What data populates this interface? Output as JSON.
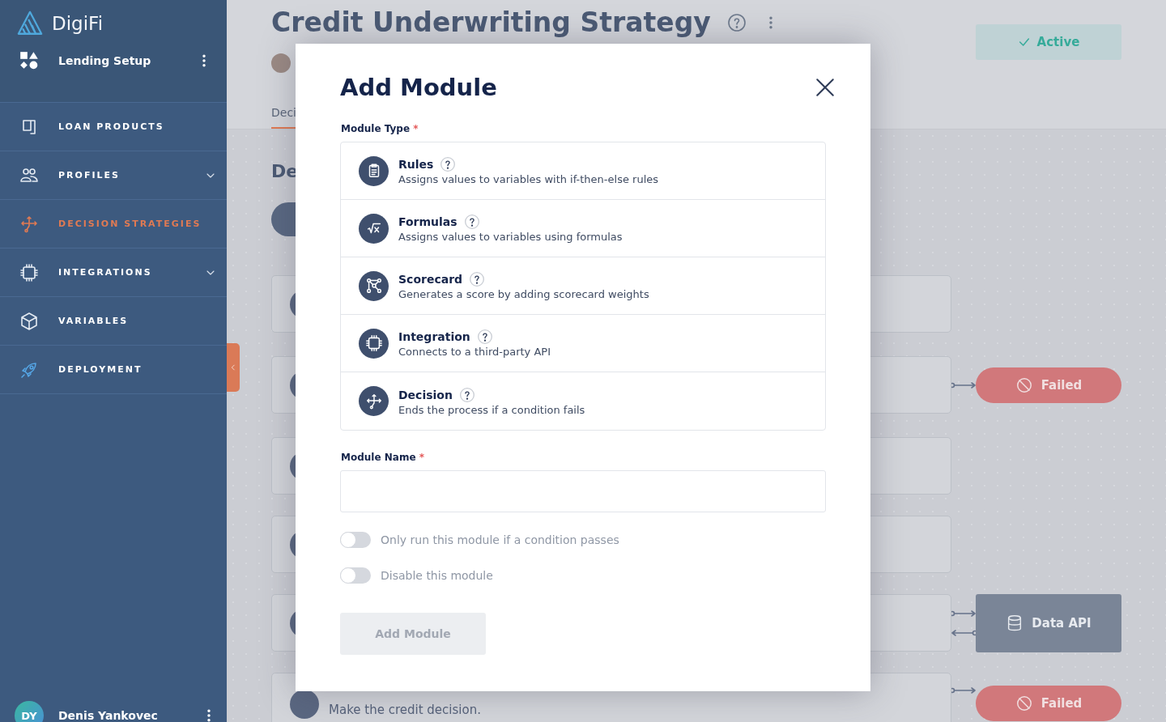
{
  "sidebar": {
    "logo": "DigiFi",
    "workspace": {
      "label": "Lending Setup"
    },
    "items": [
      {
        "kind": "products",
        "label": "LOAN PRODUCTS",
        "selected": false,
        "expandable": false
      },
      {
        "kind": "profiles",
        "label": "PROFILES",
        "selected": false,
        "expandable": true
      },
      {
        "kind": "strategies",
        "label": "DECISION STRATEGIES",
        "selected": true,
        "expandable": false
      },
      {
        "kind": "integrations",
        "label": "INTEGRATIONS",
        "selected": false,
        "expandable": true
      },
      {
        "kind": "variables",
        "label": "VARIABLES",
        "selected": false,
        "expandable": false
      },
      {
        "kind": "deployment",
        "label": "DEPLOYMENT",
        "selected": false,
        "expandable": false
      }
    ],
    "user": {
      "initials": "DY",
      "name": "Denis Yankovec"
    }
  },
  "header": {
    "title": "Credit Underwriting Strategy",
    "status": "Active",
    "tabs": [
      {
        "label": "Deci",
        "selected": true
      }
    ]
  },
  "canvas": {
    "heading": "De",
    "rows": [
      {
        "outcome": null
      },
      {
        "outcome": {
          "kind": "failed",
          "label": "Failed"
        }
      },
      {
        "outcome": null
      },
      {
        "outcome": null
      },
      {
        "outcome": {
          "kind": "data",
          "label": "Data API"
        }
      },
      {
        "description": "Make the credit decision.",
        "outcome": {
          "kind": "failed",
          "label": "Failed"
        }
      }
    ]
  },
  "modal": {
    "title": "Add Module",
    "required_mark": "*",
    "type_label": {
      "text": "Module Type",
      "required": true
    },
    "types": [
      {
        "kind": "rules",
        "name": "Rules",
        "description": "Assigns values to variables with if-then-else rules",
        "selected": false
      },
      {
        "kind": "formulas",
        "name": "Formulas",
        "description": "Assigns values to variables using formulas",
        "selected": false
      },
      {
        "kind": "scorecard",
        "name": "Scorecard",
        "description": "Generates a score by adding scorecard weights",
        "selected": false
      },
      {
        "kind": "integration",
        "name": "Integration",
        "description": "Connects to a third-party API",
        "selected": false
      },
      {
        "kind": "decision",
        "name": "Decision",
        "description": "Ends the process if a condition fails",
        "selected": false
      }
    ],
    "name_label": {
      "text": "Module Name",
      "required": true
    },
    "toggles": [
      {
        "label": "Only run this module if a condition passes",
        "on": false
      },
      {
        "label": "Disable this module",
        "on": false
      }
    ],
    "submit": {
      "label": "Add Module",
      "disabled": true
    }
  }
}
